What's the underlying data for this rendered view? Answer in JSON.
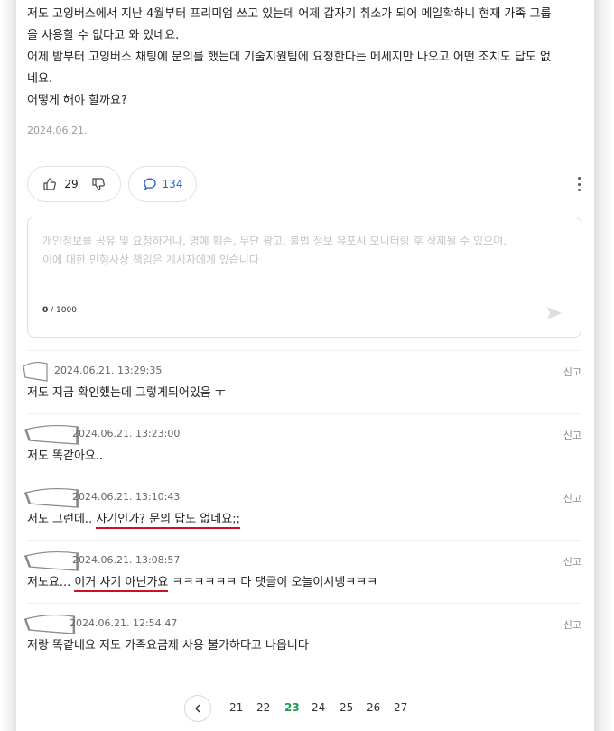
{
  "post": {
    "lines": [
      "저도 고잉버스에서 지난 4월부터 프리미엄 쓰고 있는데 어제 갑자기 취소가 되어 메일확하니  현재 가족 그룹",
      "을 사용할 수 없다고 와 있네요.",
      "어제 밤부터 고잉버스 채팅에  문의를 했는데 기술지원팀에 요청한다는 메세지만 나오고 어떤 조치도 답도 없",
      "네요.",
      "어떻게 해야 할까요?"
    ],
    "date": "2024.06.21.",
    "like_count": "29",
    "comment_count": "134",
    "icons": {
      "like": "thumbs-up-icon",
      "dislike": "thumbs-down-icon",
      "comment": "speech-bubble-icon",
      "more": "more-vertical-icon",
      "send": "send-icon",
      "prev": "chevron-left-icon"
    }
  },
  "comment_input": {
    "placeholder_line1": "개인정보를 공유 및 요청하거나, 명예 훼손, 무단 광고, 불법 정보 유포시 모니터링 후 삭제될 수 있으며,",
    "placeholder_line2": "이에 대한 민형사상 책임은 게시자에게 있습니다",
    "count_current": "0",
    "count_max": " / 1000"
  },
  "comments": [
    {
      "date": "2024.06.21. 13:29:35",
      "report": "신고",
      "text": "저도 지금 확인했는데 그렇게되어있음 ㅜ"
    },
    {
      "date": "2024.06.21. 13:23:00",
      "report": "신고",
      "text": "저도 똑같아요.."
    },
    {
      "date": "2024.06.21. 13:10:43",
      "report": "신고",
      "text_before": "저도 그런데.. ",
      "text_underlined": "사기인가? 문의 답도 없네요;;"
    },
    {
      "date": "2024.06.21. 13:08:57",
      "report": "신고",
      "text_before": "저노요... ",
      "text_underlined": "이거 사기 아닌가요",
      "text_after": " ㅋㅋㅋㅋㅋㅋ 다 댓글이 오늘이시넹ㅋㅋㅋ"
    },
    {
      "date": "2024.06.21. 12:54:47",
      "report": "신고",
      "text": "저랑 똑같네요 저도 가족요금제 사용 불가하다고 나옵니다"
    }
  ],
  "pagination": {
    "pages": [
      "21",
      "22",
      "23",
      "24",
      "25",
      "26",
      "27"
    ],
    "current": "23"
  },
  "colors": {
    "accent_blue": "#2a62c9",
    "current_page_green": "#1f9a52",
    "underline_red": "#c8122a"
  }
}
